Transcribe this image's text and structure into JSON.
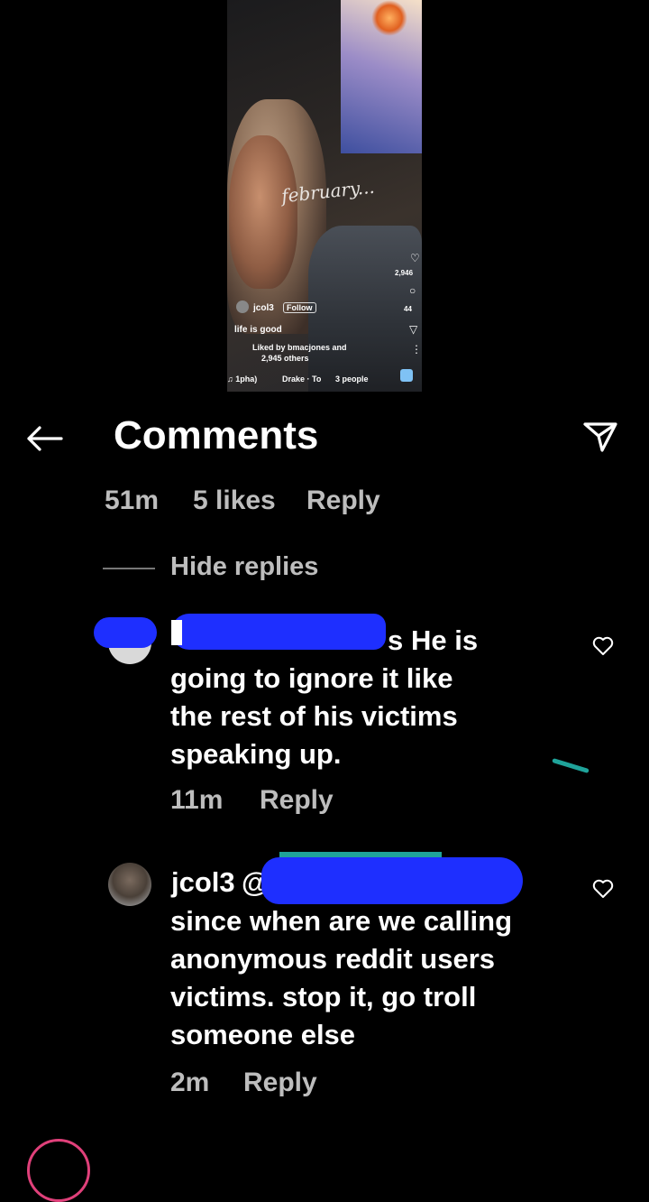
{
  "story": {
    "caption_script": "february...",
    "username": "jcol3",
    "follow_label": "Follow",
    "caption": "life is good",
    "liked_by": "Liked by bmacjones and",
    "liked_others": "2,945 others",
    "music": "♫ 1pha)",
    "song": "Drake · To",
    "people": "3 people",
    "like_count": "2,946",
    "comment_count": "44"
  },
  "header": {
    "title": "Comments"
  },
  "parent_meta": {
    "time": "51m",
    "likes": "5 likes",
    "reply": "Reply"
  },
  "hide_replies": "Hide replies",
  "replies": [
    {
      "username_suffix": "s",
      "text_first": "He is",
      "text_lines": [
        "going to ignore it like",
        "the rest of his victims",
        "speaking up."
      ],
      "time": "11m",
      "reply": "Reply"
    },
    {
      "username": "jcol3",
      "mention_start": "@",
      "text_lines": [
        "since when are we calling",
        "anonymous reddit users",
        "victims. stop it, go troll",
        "someone else"
      ],
      "time": "2m",
      "reply": "Reply"
    }
  ],
  "icons": [
    "back-arrow-icon",
    "share-icon",
    "heart-icon"
  ],
  "colors": {
    "background": "#000000",
    "redaction": "#1e2fff",
    "meta_text": "#bdbdbd"
  }
}
